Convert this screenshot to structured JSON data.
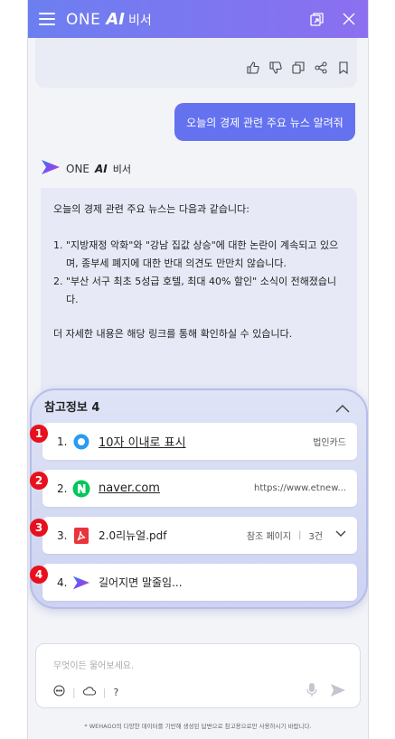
{
  "header": {
    "brand_one": "ONE",
    "brand_ai": "AI",
    "brand_suffix": "비서"
  },
  "user_message": "오늘의 경제 관련 주요 뉴스 알려줘",
  "assistant": {
    "label_one": "ONE",
    "label_ai": "AI",
    "label_suffix": "비서",
    "intro": "오늘의 경제 관련 주요 뉴스는 다음과 같습니다:",
    "items": [
      "\"지방재정 악화\"와 \"강남 집값 상승\"에 대한 논란이 계속되고 있으며, 종부세 폐지에 대한 반대 의견도 만만치 않습니다.",
      "\"부산 서구 최초 5성급 호텔, 최대 40% 할인\" 소식이 전해졌습니다."
    ],
    "outro": "더 자세한 내용은 해당 링크를 통해 확인하실 수 있습니다."
  },
  "references": {
    "title": "참고정보 4",
    "items": [
      {
        "num": "1.",
        "marker": "1",
        "name": "10자 이내로 표시",
        "meta": "법인카드"
      },
      {
        "num": "2.",
        "marker": "2",
        "name": "naver.com",
        "meta": "https://www.etnew..."
      },
      {
        "num": "3.",
        "marker": "3",
        "name": "2.0리뉴얼.pdf",
        "meta": "참조 페이지",
        "meta_count": "3건"
      },
      {
        "num": "4.",
        "marker": "4",
        "name": "길어지면 말줄임..."
      }
    ]
  },
  "input": {
    "placeholder": "무엇이든 물어보세요.",
    "help": "?"
  },
  "disclaimer": "* WEHAGO의 다양한 데이터를 기반해 생성된 답변으로 참고용으로만 사용하시기 바랍니다.",
  "colors": {
    "header_start": "#6c7ff0",
    "header_end": "#8c6ff0",
    "user_bubble": "#6472f0",
    "marker": "#e8101c",
    "naver_green": "#03c75a",
    "pdf_red": "#e8343a"
  }
}
